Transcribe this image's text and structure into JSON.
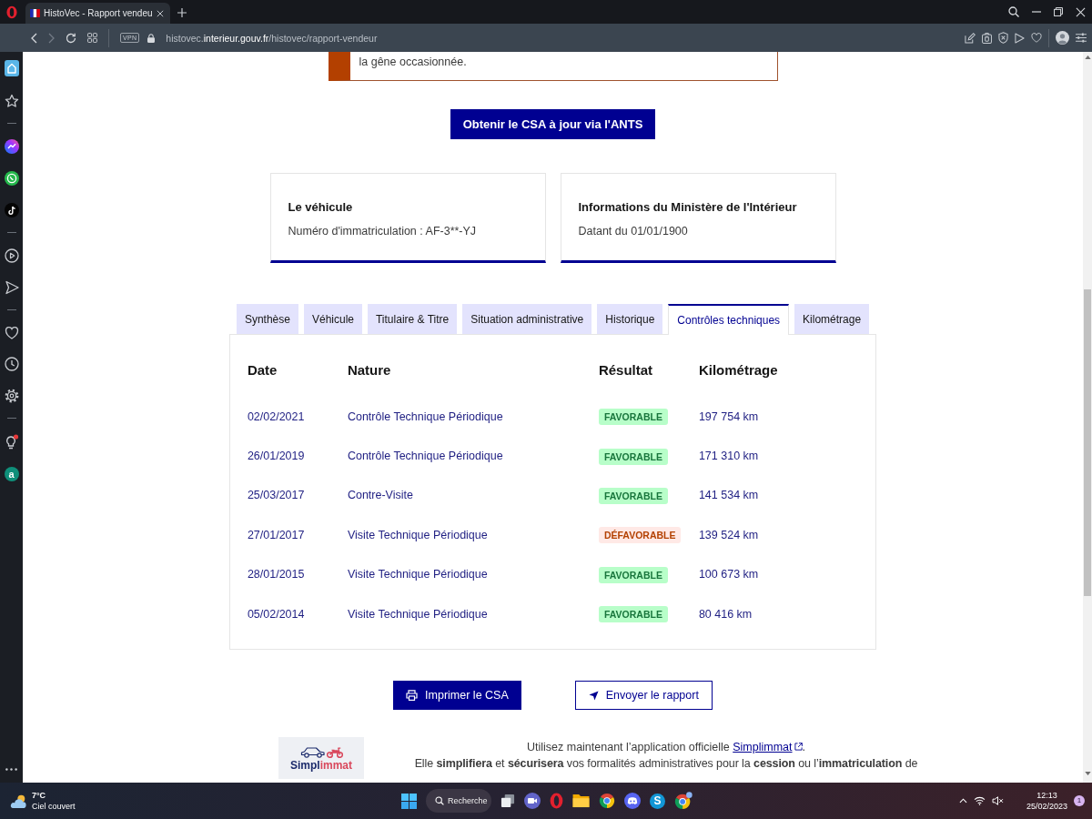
{
  "browser": {
    "tab_title": "HistoVec - Rapport vendeu",
    "vpn_badge": "VPN",
    "url": {
      "subdomain": "histovec.",
      "domain": "interieur.gouv.fr",
      "path": "/histovec/rapport-vendeur"
    }
  },
  "sidebar": {
    "app_letter": "a"
  },
  "alert": {
    "text": "la gêne occasionnée."
  },
  "ants_button": {
    "label": "Obtenir le CSA à jour via l'ANTS"
  },
  "cards": [
    {
      "title": "Le véhicule",
      "text": "Numéro d'immatriculation : AF-3**-YJ"
    },
    {
      "title": "Informations du Ministère de l'Intérieur",
      "text": "Datant du 01/01/1900"
    }
  ],
  "tabs": [
    {
      "label": "Synthèse",
      "selected": false
    },
    {
      "label": "Véhicule",
      "selected": false
    },
    {
      "label": "Titulaire & Titre",
      "selected": false
    },
    {
      "label": "Situation administrative",
      "selected": false
    },
    {
      "label": "Historique",
      "selected": false
    },
    {
      "label": "Contrôles techniques",
      "selected": true
    },
    {
      "label": "Kilométrage",
      "selected": false
    }
  ],
  "table": {
    "columns": [
      "Date",
      "Nature",
      "Résultat",
      "Kilométrage"
    ],
    "rows": [
      {
        "date": "02/02/2021",
        "nature": "Contrôle Technique Périodique",
        "result": {
          "label": "FAVORABLE",
          "kind": "success"
        },
        "mileage": "197 754 km"
      },
      {
        "date": "26/01/2019",
        "nature": "Contrôle Technique Périodique",
        "result": {
          "label": "FAVORABLE",
          "kind": "success"
        },
        "mileage": "171 310 km"
      },
      {
        "date": "25/03/2017",
        "nature": "Contre-Visite",
        "result": {
          "label": "FAVORABLE",
          "kind": "success"
        },
        "mileage": "141 534 km"
      },
      {
        "date": "27/01/2017",
        "nature": "Visite Technique Périodique",
        "result": {
          "label": "DÉFAVORABLE",
          "kind": "error"
        },
        "mileage": "139 524 km"
      },
      {
        "date": "28/01/2015",
        "nature": "Visite Technique Périodique",
        "result": {
          "label": "FAVORABLE",
          "kind": "success"
        },
        "mileage": "100 673 km"
      },
      {
        "date": "05/02/2014",
        "nature": "Visite Technique Périodique",
        "result": {
          "label": "FAVORABLE",
          "kind": "success"
        },
        "mileage": "80 416 km"
      }
    ]
  },
  "actions": [
    {
      "label": "Imprimer le CSA",
      "kind": "primary"
    },
    {
      "label": "Envoyer le rapport",
      "kind": "secondary"
    }
  ],
  "footer": {
    "logo_wordmark": [
      "Simpl",
      "immat"
    ],
    "promo": {
      "before": "Utilisez maintenant l’application officielle ",
      "link": "Simplimmat",
      "after": "."
    },
    "description": "Elle **simplifiera** et **sécurisera** vos formalités administratives pour la **cession** ou l’**immatriculation** de"
  },
  "taskbar": {
    "weather": {
      "temperature": "7°C",
      "condition": "Ciel couvert"
    },
    "search": {
      "placeholder": "Recherche"
    },
    "app_letter": "S",
    "clock": {
      "time": "12:13",
      "date": "25/02/2023"
    },
    "notification_count": "1"
  }
}
